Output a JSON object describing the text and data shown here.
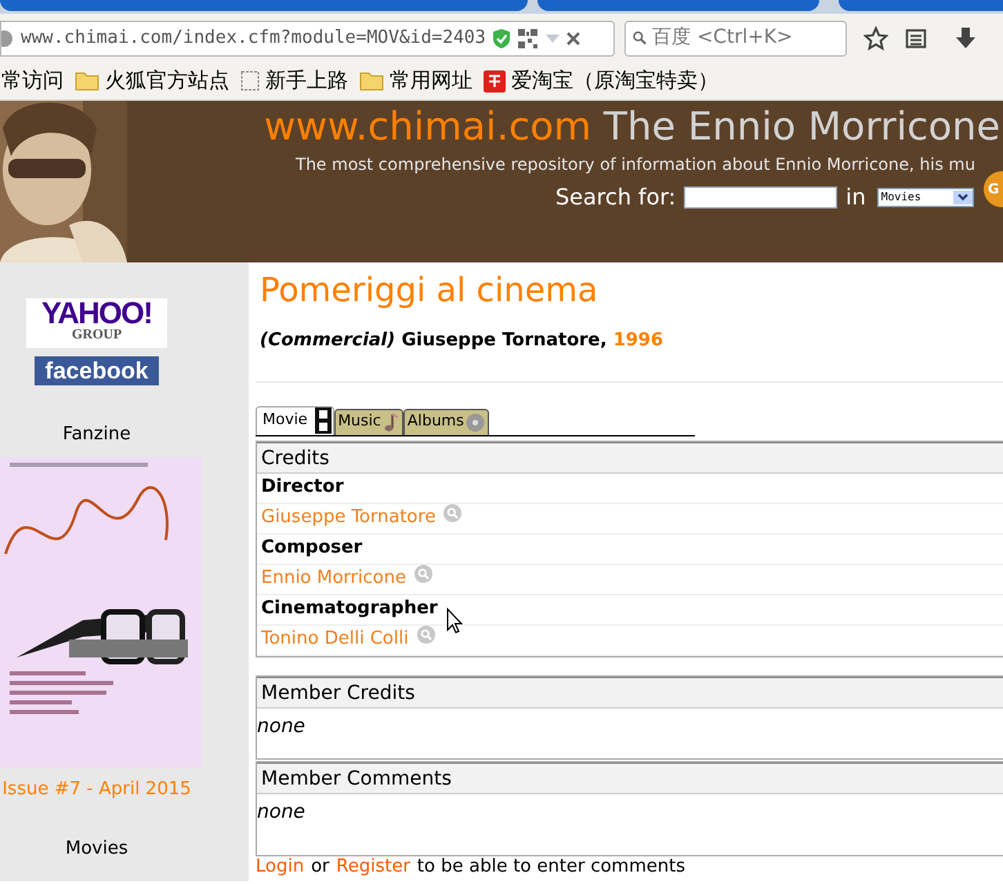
{
  "browser": {
    "url": "www.chimai.com/index.cfm?module=MOV&id=2403",
    "search_placeholder": "百度 <Ctrl+K>",
    "bookmarks": [
      {
        "label": "常访问",
        "kind": "plain"
      },
      {
        "label": "火狐官方站点",
        "kind": "folder"
      },
      {
        "label": "新手上路",
        "kind": "page"
      },
      {
        "label": "常用网址",
        "kind": "folder"
      },
      {
        "label": "爱淘宝（原淘宝特卖）",
        "kind": "taobao"
      }
    ]
  },
  "header": {
    "site": "www.chimai.com",
    "title": " The Ennio Morricone",
    "tagline": "The most comprehensive repository of information about Ennio Morricone, his mu",
    "search_label": "Search for:",
    "in_label": "in",
    "select_value": "Movies",
    "go_button": "G"
  },
  "sidebar": {
    "yahoo": "YAHOO!",
    "yahoo_sub": "GROUP",
    "facebook": "facebook",
    "fanzine_heading": "Fanzine",
    "issue_link": "Issue #7 - April 2015",
    "movies_heading": "Movies"
  },
  "movie": {
    "title": "Pomeriggi al cinema",
    "subtitle": "*(Commercial)* Giuseppe Tornatore, ",
    "year": "1996",
    "tabs": [
      {
        "label": "Movie",
        "selected": true,
        "kind": "film"
      },
      {
        "label": "Music",
        "selected": false,
        "kind": "note"
      },
      {
        "label": "Albums",
        "selected": false,
        "kind": "disc"
      }
    ],
    "credits": {
      "heading": "Credits",
      "rows": [
        {
          "kind": "role",
          "text": "Director"
        },
        {
          "kind": "person",
          "text": "Giuseppe Tornatore"
        },
        {
          "kind": "role",
          "text": "Composer"
        },
        {
          "kind": "person",
          "text": "Ennio Morricone"
        },
        {
          "kind": "role",
          "text": "Cinematographer"
        },
        {
          "kind": "person",
          "text": "Tonino Delli Colli"
        }
      ]
    },
    "member_credits": {
      "heading": "Member Credits",
      "text": "none"
    },
    "member_comments": {
      "heading": "Member Comments",
      "text": "none"
    },
    "login_line": {
      "login": "Login",
      "or": "or",
      "register": "Register",
      "rest": "to be able to enter comments"
    }
  }
}
